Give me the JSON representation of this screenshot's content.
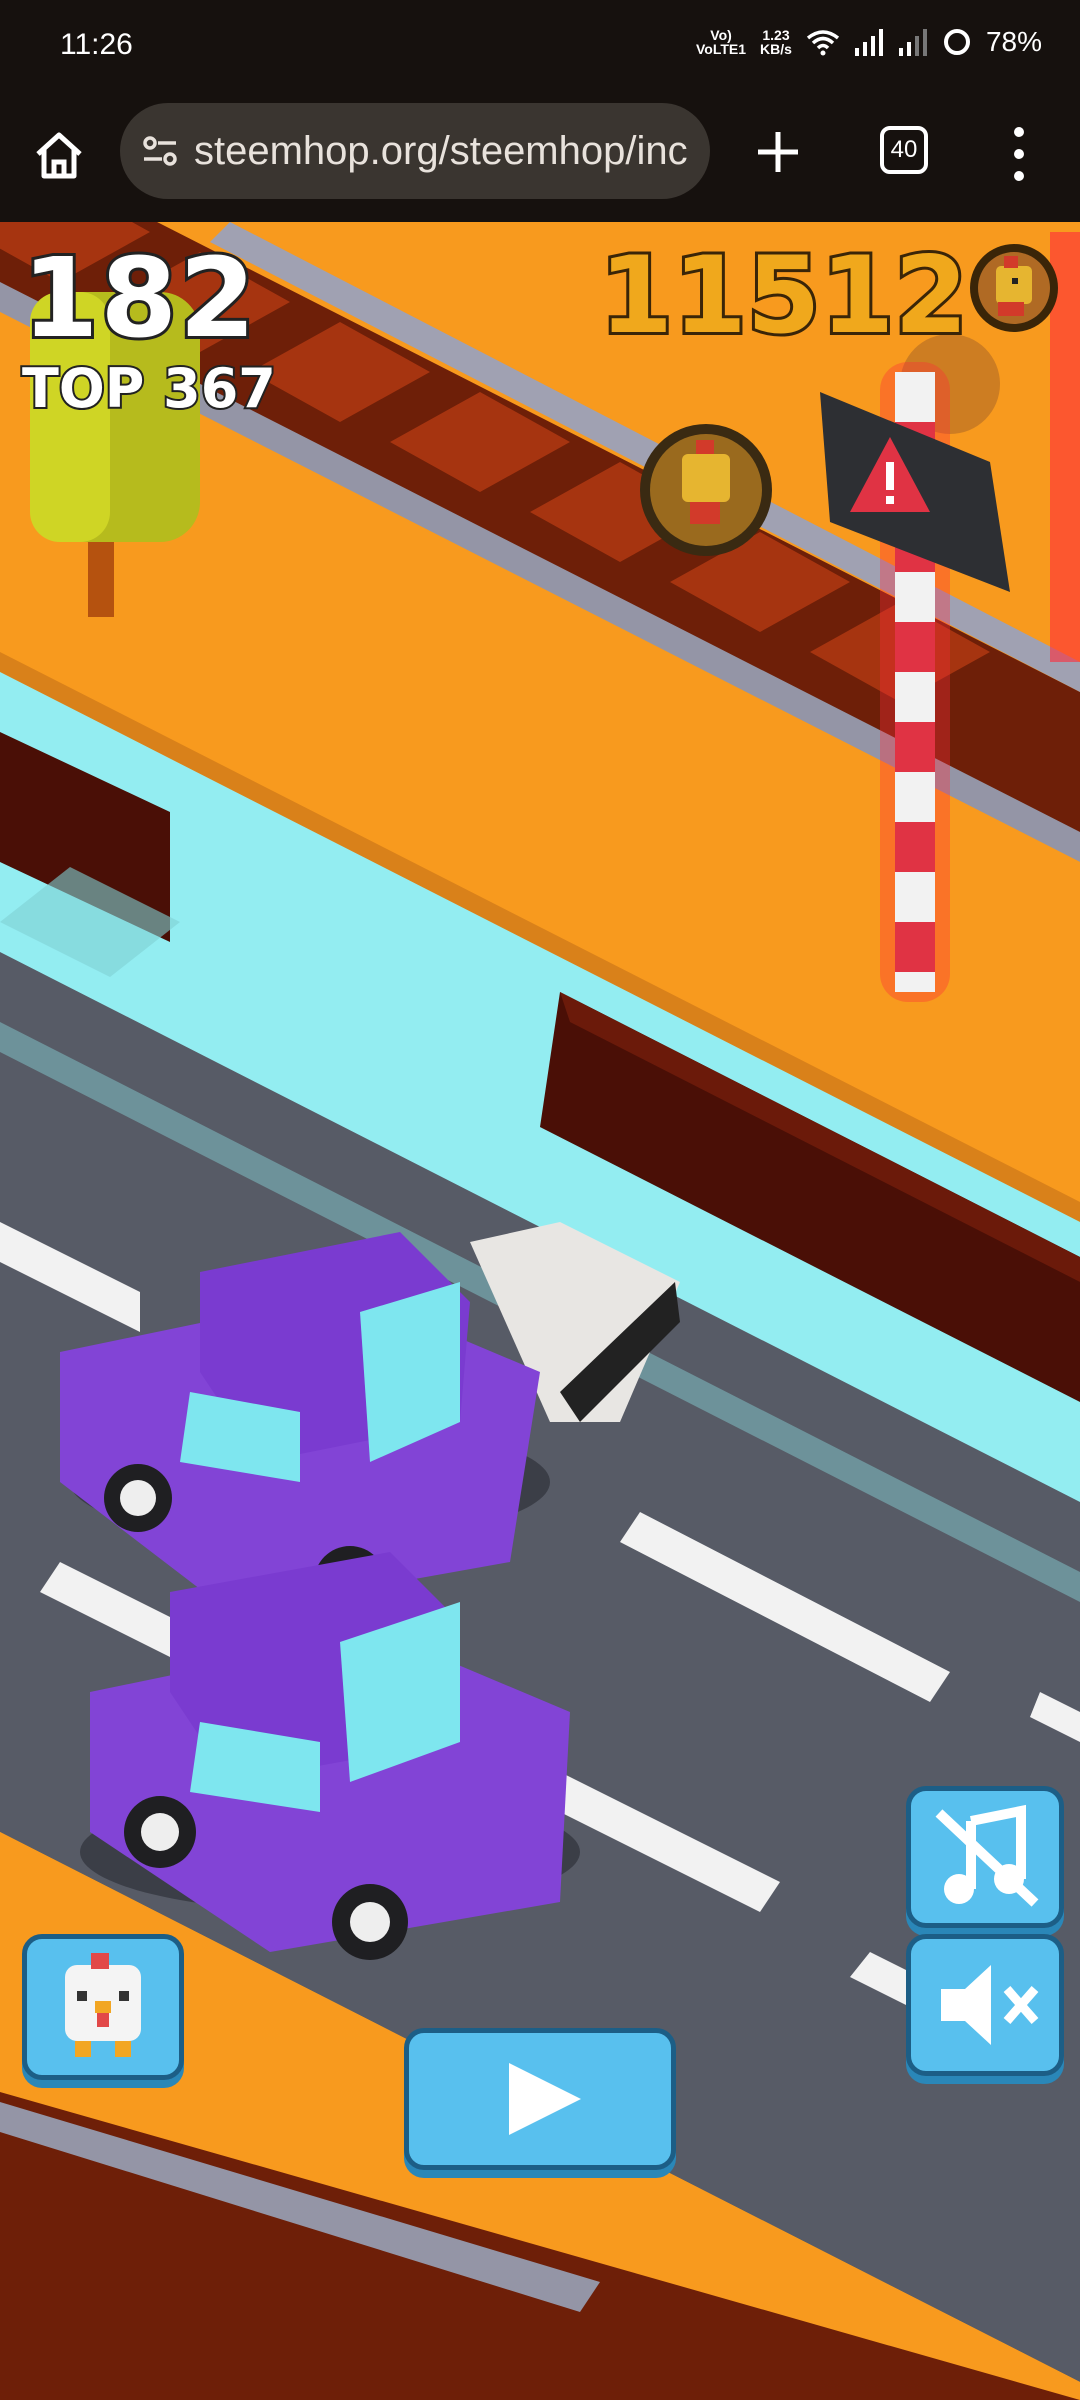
{
  "status_bar": {
    "time": "11:26",
    "volte": "VoLTE1",
    "speed_value": "1.23",
    "speed_unit": "KB/s",
    "battery": "78%",
    "icons": [
      "wifi-icon",
      "signal-icon",
      "signal-weak-icon",
      "battery-ring-icon"
    ]
  },
  "browser": {
    "url": "steemhop.org/steemhop/inc",
    "tab_count": "40",
    "icons": [
      "home-icon",
      "site-settings-icon",
      "plus-icon",
      "menu-dots-icon"
    ]
  },
  "game": {
    "score": "182",
    "top_label": "TOP 367",
    "coins": "11512",
    "icons": [
      "chicken-coin-icon",
      "character-select-icon",
      "play-icon",
      "music-muted-icon",
      "sound-muted-icon",
      "railroad-warning-sign-icon",
      "coin-icon"
    ],
    "colors": {
      "grass": "#f89a1e",
      "water": "#93edf1",
      "road": "#575b66",
      "car": "#8244d6",
      "button": "#58c0ee"
    }
  }
}
